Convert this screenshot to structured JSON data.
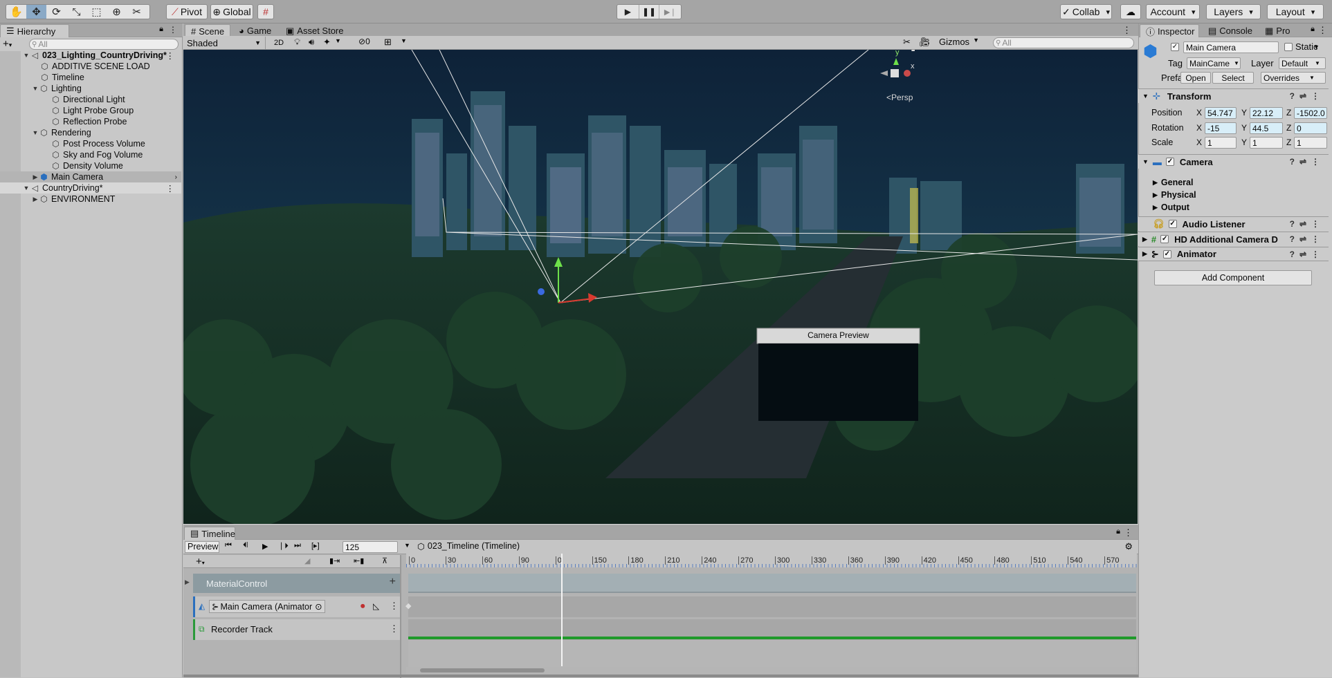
{
  "toolbar": {
    "pivot": "Pivot",
    "global": "Global",
    "collab": "Collab",
    "account": "Account",
    "layers": "Layers",
    "layout": "Layout"
  },
  "hierarchy": {
    "tab": "Hierarchy",
    "search_placeholder": "All",
    "items": [
      {
        "label": "023_Lighting_CountryDriving*",
        "bold": true
      },
      {
        "label": "ADDITIVE SCENE LOAD"
      },
      {
        "label": "Timeline"
      },
      {
        "label": "Lighting"
      },
      {
        "label": "Directional Light"
      },
      {
        "label": "Light Probe Group"
      },
      {
        "label": "Reflection Probe"
      },
      {
        "label": "Rendering"
      },
      {
        "label": "Post Process Volume"
      },
      {
        "label": "Sky and Fog Volume"
      },
      {
        "label": "Density Volume"
      },
      {
        "label": "Main Camera"
      },
      {
        "label": "CountryDriving*"
      },
      {
        "label": "ENVIRONMENT"
      }
    ]
  },
  "scene": {
    "tabs": [
      "Scene",
      "Game",
      "Asset Store"
    ],
    "shading": "Shaded",
    "mode_2d": "2D",
    "hidden_count": "0",
    "gizmos": "Gizmos",
    "search_placeholder": "All",
    "persp": "Persp",
    "camera_preview": "Camera Preview",
    "axis_y": "y",
    "axis_x": "x"
  },
  "inspector": {
    "tabs": [
      "Inspector",
      "Console",
      "Pro"
    ],
    "object_name": "Main Camera",
    "static_label": "Static",
    "tag_label": "Tag",
    "tag_value": "MainCame",
    "layer_label": "Layer",
    "layer_value": "Default",
    "prefab_label": "Prefab",
    "open": "Open",
    "select": "Select",
    "overrides": "Overrides",
    "transform": {
      "title": "Transform",
      "position_label": "Position",
      "rotation_label": "Rotation",
      "scale_label": "Scale",
      "position": {
        "x": "54.747",
        "y": "22.12",
        "z": "-1502.0"
      },
      "rotation": {
        "x": "-15",
        "y": "44.5",
        "z": "0"
      },
      "scale": {
        "x": "1",
        "y": "1",
        "z": "1"
      }
    },
    "camera": {
      "title": "Camera",
      "sections": [
        "General",
        "Physical",
        "Output"
      ]
    },
    "audio_listener": "Audio Listener",
    "hd_camera": "HD Additional Camera Da",
    "animator": "Animator",
    "add_component": "Add Component",
    "axis": {
      "x": "X",
      "y": "Y",
      "z": "Z"
    }
  },
  "timeline": {
    "tab": "Timeline",
    "preview": "Preview",
    "frame": "125",
    "asset": "023_Timeline (Timeline)",
    "ticks": [
      "0",
      "30",
      "60",
      "90",
      "0",
      "150",
      "180",
      "210",
      "240",
      "270",
      "300",
      "330",
      "360",
      "390",
      "420",
      "450",
      "480",
      "510",
      "540",
      "570"
    ],
    "playhead_frame": 125,
    "tracks": {
      "group": "MaterialControl",
      "animator": "Main Camera (Animator",
      "recorder": "Recorder Track"
    }
  }
}
